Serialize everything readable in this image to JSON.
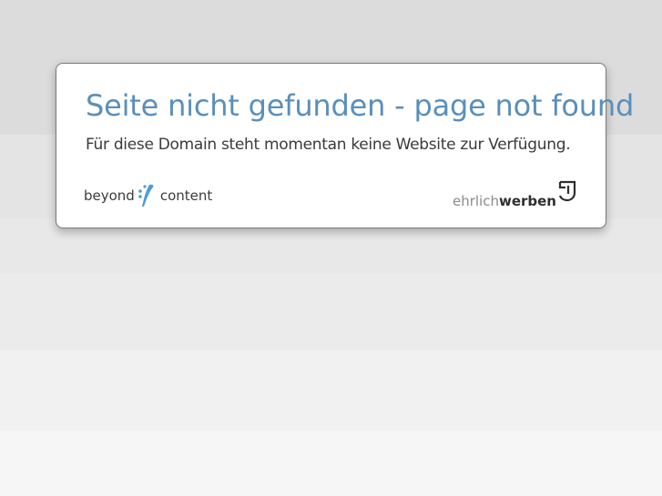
{
  "page": {
    "title": "Seite nicht gefunden - page not found",
    "message": "Für diese Domain steht momentan keine Website zur Verfügung."
  },
  "logos": {
    "left": {
      "word1": "beyond",
      "word2": "content",
      "icon": "splash-icon",
      "accent_color": "#4a9fd3"
    },
    "right": {
      "light_text": "ehrlich",
      "bold_text": "werben",
      "icon": "ehrlichwerben-mark-icon"
    }
  },
  "colors": {
    "title": "#5a8fbb",
    "text": "#3a3a3a"
  }
}
